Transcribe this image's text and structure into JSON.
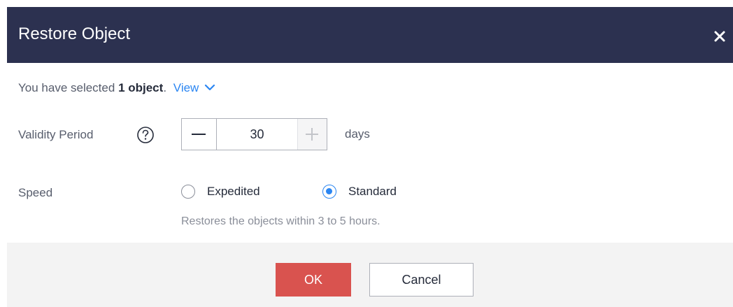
{
  "dialog": {
    "title": "Restore Object",
    "close_icon": "close-icon"
  },
  "selection": {
    "prefix": "You have selected",
    "count_label": "1 object",
    "suffix": ".",
    "view_link": "View",
    "view_icon": "chevron-down-icon"
  },
  "validity": {
    "label": "Validity Period",
    "help_icon": "question-circle-icon",
    "value": "30",
    "unit": "days",
    "minus_icon": "minus-icon",
    "plus_icon": "plus-icon",
    "plus_disabled": true
  },
  "speed": {
    "label": "Speed",
    "options": [
      {
        "label": "Expedited",
        "checked": false
      },
      {
        "label": "Standard",
        "checked": true
      }
    ],
    "hint": "Restores the objects within 3 to 5 hours."
  },
  "footer": {
    "ok_label": "OK",
    "cancel_label": "Cancel"
  },
  "colors": {
    "header_bg": "#2c3150",
    "accent_blue": "#2b86f2",
    "ok_red": "#d9534f",
    "footer_bg": "#f3f3f3"
  }
}
